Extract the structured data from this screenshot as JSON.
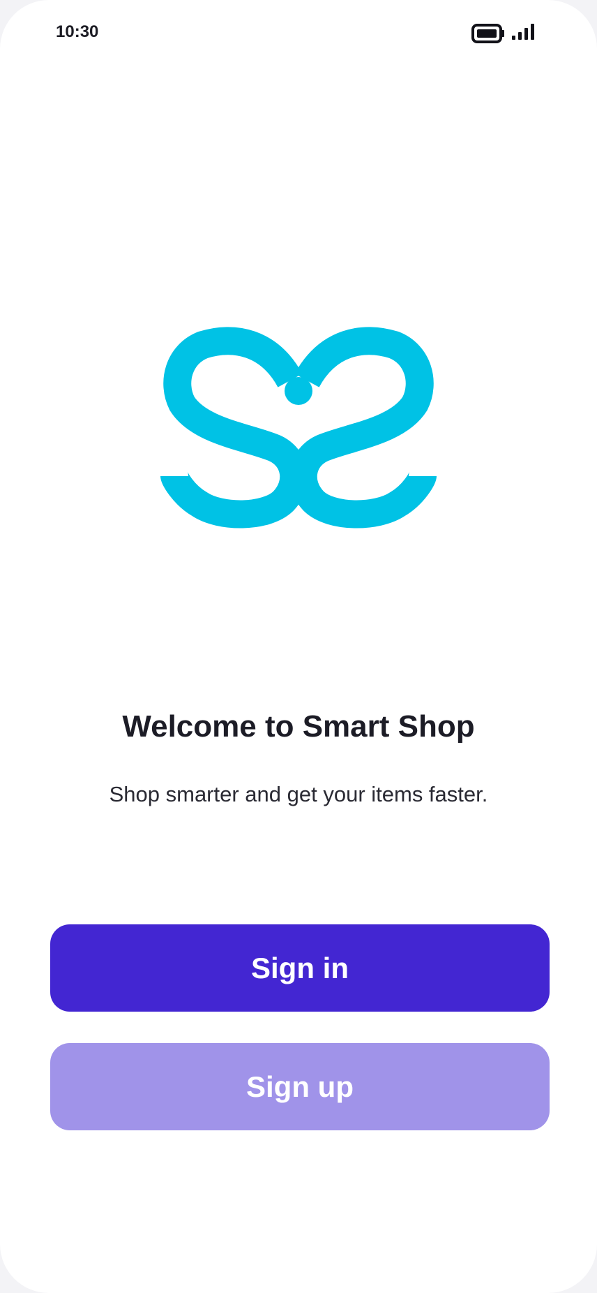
{
  "status_bar": {
    "time": "10:30",
    "battery_icon": "battery-icon",
    "signal_icon": "signal-icon"
  },
  "logo": {
    "icon": "smart-shop-logo-icon",
    "color": "#00c2e5"
  },
  "welcome": {
    "title": "Welcome to Smart Shop",
    "subtitle": "Shop smarter and get your items faster."
  },
  "actions": {
    "sign_in_label": "Sign in",
    "sign_up_label": "Sign up"
  },
  "colors": {
    "primary": "#4326d2",
    "secondary": "#a093e9",
    "background": "#ffffff"
  }
}
